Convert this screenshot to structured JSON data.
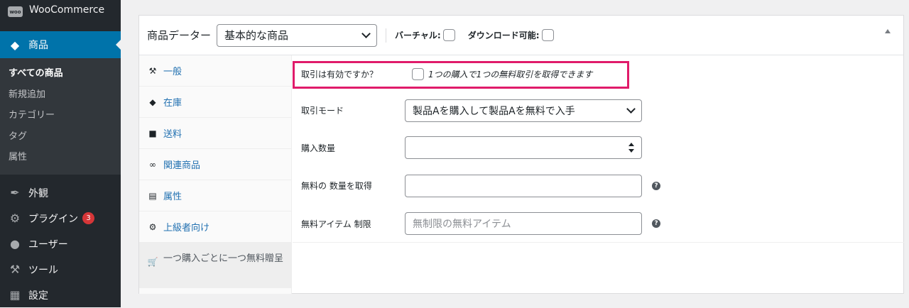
{
  "sidebar": {
    "woocommerce_label": "WooCommerce",
    "woo_logo_text": "woo",
    "products_label": "商品",
    "submenu": [
      "すべての商品",
      "新規追加",
      "カテゴリー",
      "タグ",
      "属性"
    ],
    "appearance_label": "外観",
    "plugins_label": "プラグイン",
    "plugins_badge": "3",
    "users_label": "ユーザー",
    "tools_label": "ツール",
    "settings_label": "設定"
  },
  "panel": {
    "title": "商品データー",
    "product_type": "基本的な商品",
    "virtual_label": "バーチャル:",
    "downloadable_label": "ダウンロード可能:"
  },
  "tabs": [
    "一般",
    "在庫",
    "送料",
    "関連商品",
    "属性",
    "上級者向け",
    "一つ購入ごとに一つ無料贈呈"
  ],
  "options": {
    "deal_enabled_label": "取引は有効ですか？",
    "deal_enabled_desc": "1つの購入で1つの無料取引を取得できます",
    "deal_mode_label": "取引モード",
    "deal_mode_value": "製品Aを購入して製品Aを無料で入手",
    "purchase_qty_label": "購入数量",
    "free_qty_label": "無料の 数量を取得",
    "free_limit_label": "無料アイテム 制限",
    "free_limit_placeholder": "無制限の無料アイテム",
    "help_glyph": "?"
  }
}
